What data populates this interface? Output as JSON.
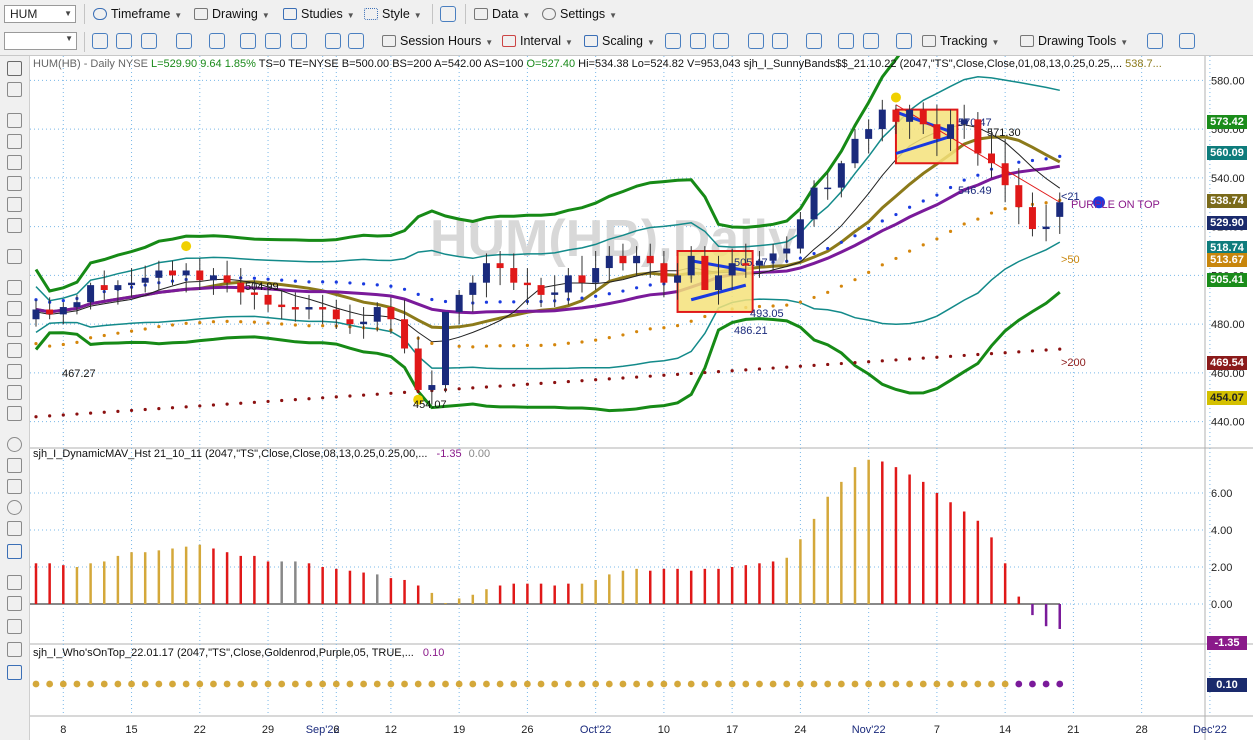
{
  "toolbar1": {
    "symbol": "HUM",
    "items": [
      "Timeframe",
      "Drawing",
      "Studies",
      "Style",
      "Data",
      "Settings"
    ]
  },
  "toolbar2": {
    "items": [
      "Session Hours",
      "Interval",
      "Scaling",
      "Tracking",
      "Drawing Tools"
    ]
  },
  "price_pane": {
    "watermark": "HUM(HB),Daily",
    "header": {
      "symbol": "HUM(HB) - Daily",
      "exchange": "NYSE",
      "last": "L=529.90",
      "change": "9.64",
      "change_pct": "1.85%",
      "fields": "TS=0 TE=NYSE B=500.00 BS=200 A=542.00 AS=100",
      "open": "O=527.40",
      "rest": "Hi=534.38 Lo=524.82 V=953,043",
      "study": "sjh_I_SunnyBands$$_21.10.22 (2047,\"TS\",Close,Close,01,08,13,0.25,0.25,...",
      "study_val": "538.7..."
    },
    "axis_ticks": [
      "580.00",
      "560.00",
      "540.00",
      "520.00",
      "500.00",
      "480.00",
      "460.00",
      "440.00"
    ],
    "tags": [
      {
        "text": "573.42",
        "color": "#1a8c1a"
      },
      {
        "text": "560.09",
        "color": "#0e7c7c"
      },
      {
        "text": "538.74",
        "color": "#7a6a1a"
      },
      {
        "text": "529.90",
        "color": "#1a2a6c"
      },
      {
        "text": "518.74",
        "color": "#0e7c7c"
      },
      {
        "text": "513.67",
        "color": "#c8860c"
      },
      {
        "text": "505.41",
        "color": "#1a8c1a"
      },
      {
        "text": "469.54",
        "color": "#8b1a1a"
      },
      {
        "text": "454.07",
        "color": "#d4c000"
      }
    ],
    "annotations": {
      "a570": "570.47",
      "a571": "571.30",
      "a546": "546.49",
      "a504": "504.99",
      "a505": "505.47",
      "a493": "493.05",
      "a486": "486.21",
      "a467": "467.27",
      "a454": "454.07",
      "ma21": "<21",
      "ma50": ">50",
      "ma200": ">200",
      "purple": "PURPLE ON TOP"
    }
  },
  "osc_pane": {
    "header": "sjh_I_DynamicMAV_Hst 21_10_11 (2047,\"TS\",Close,Close,08,13,0.25,0.25,00,...",
    "val1": "-1.35",
    "val2": "0.00",
    "axis_ticks": [
      "6.00",
      "4.00",
      "2.00",
      "0.00"
    ],
    "tag": "-1.35"
  },
  "who_pane": {
    "header": "sjh_I_Who'sOnTop_22.01.17 (2047,\"TS\",Close,Goldenrod,Purple,05, TRUE,...",
    "val": "0.10",
    "tag": "0.10"
  },
  "date_axis": [
    "8",
    "15",
    "22",
    "29",
    "Sep'22",
    "6",
    "12",
    "19",
    "26",
    "Oct'22",
    "10",
    "17",
    "24",
    "Nov'22",
    "7",
    "14",
    "21",
    "28",
    "Dec'22"
  ],
  "colors": {
    "up": "#1a2a7c",
    "down": "#e01818",
    "band_outer": "#168a16",
    "band_inner": "#138a8a",
    "ma21": "#7a1a9a",
    "ma_gold": "#8c7a1a",
    "dots_blue": "#1a3ae0",
    "dots_orange": "#d4860c",
    "dots_red": "#8b1010",
    "grid": "#7ab8e8"
  },
  "chart_data": [
    {
      "type": "candlestick",
      "title": "HUM(HB),Daily",
      "dates": [
        "Aug 4",
        "Aug 5",
        "Aug 8",
        "Aug 9",
        "Aug 10",
        "Aug 11",
        "Aug 12",
        "Aug 15",
        "Aug 16",
        "Aug 17",
        "Aug 18",
        "Aug 19",
        "Aug 22",
        "Aug 23",
        "Aug 24",
        "Aug 25",
        "Aug 26",
        "Aug 29",
        "Aug 30",
        "Aug 31",
        "Sep 1",
        "Sep 2",
        "Sep 6",
        "Sep 7",
        "Sep 8",
        "Sep 9",
        "Sep 12",
        "Sep 13",
        "Sep 14",
        "Sep 15",
        "Sep 16",
        "Sep 19",
        "Sep 20",
        "Sep 21",
        "Sep 22",
        "Sep 23",
        "Sep 26",
        "Sep 27",
        "Sep 28",
        "Sep 29",
        "Sep 30",
        "Oct 3",
        "Oct 4",
        "Oct 5",
        "Oct 6",
        "Oct 7",
        "Oct 10",
        "Oct 11",
        "Oct 12",
        "Oct 13",
        "Oct 14",
        "Oct 17",
        "Oct 18",
        "Oct 19",
        "Oct 20",
        "Oct 21",
        "Oct 24",
        "Oct 25",
        "Oct 26",
        "Oct 27",
        "Oct 28",
        "Oct 31",
        "Nov 1",
        "Nov 2",
        "Nov 3",
        "Nov 4",
        "Nov 7",
        "Nov 8",
        "Nov 9",
        "Nov 10",
        "Nov 11",
        "Nov 14",
        "Nov 15",
        "Nov 16",
        "Nov 17",
        "Nov 18"
      ],
      "open": [
        482,
        486,
        484,
        487,
        489,
        496,
        494,
        496,
        497,
        499,
        502,
        500,
        502,
        498,
        500,
        497,
        493,
        492,
        488,
        487,
        486,
        487,
        486,
        482,
        480,
        481,
        487,
        482,
        470,
        453,
        455,
        485,
        492,
        497,
        505,
        503,
        497,
        496,
        492,
        493,
        500,
        497,
        503,
        508,
        505,
        508,
        505,
        497,
        500,
        508,
        494,
        500,
        505,
        504,
        506,
        509,
        511,
        523,
        536,
        536,
        546,
        556,
        560,
        568,
        563,
        568,
        562,
        556,
        562,
        564,
        550,
        546,
        537,
        528,
        519,
        524
      ],
      "high": [
        490,
        491,
        489,
        492,
        497,
        502,
        498,
        503,
        504,
        506,
        506,
        505,
        507,
        503,
        506,
        503,
        498,
        496,
        494,
        493,
        492,
        492,
        490,
        488,
        487,
        489,
        491,
        490,
        475,
        461,
        477,
        494,
        500,
        509,
        510,
        509,
        503,
        499,
        500,
        503,
        508,
        510,
        512,
        513,
        512,
        513,
        510,
        505,
        512,
        512,
        508,
        511,
        513,
        510,
        513,
        516,
        526,
        539,
        542,
        547,
        560,
        564,
        572,
        570,
        570,
        571,
        570,
        568,
        570,
        567,
        560,
        556,
        544,
        534,
        529,
        534
      ],
      "low": [
        479,
        482,
        480,
        484,
        486,
        490,
        488,
        491,
        493,
        494,
        496,
        493,
        494,
        492,
        493,
        488,
        486,
        485,
        482,
        481,
        482,
        480,
        478,
        476,
        474,
        477,
        476,
        468,
        454,
        447,
        452,
        480,
        485,
        491,
        496,
        494,
        488,
        487,
        487,
        488,
        493,
        494,
        498,
        502,
        500,
        499,
        491,
        490,
        497,
        494,
        488,
        494,
        499,
        499,
        502,
        505,
        509,
        520,
        531,
        532,
        544,
        550,
        555,
        558,
        556,
        558,
        549,
        551,
        556,
        545,
        540,
        530,
        521,
        516,
        514,
        517
      ],
      "close": [
        486,
        484,
        487,
        489,
        496,
        494,
        496,
        497,
        499,
        502,
        500,
        502,
        498,
        500,
        497,
        493,
        492,
        488,
        487,
        486,
        487,
        486,
        482,
        480,
        481,
        487,
        482,
        470,
        453,
        455,
        485,
        492,
        497,
        505,
        503,
        497,
        496,
        492,
        493,
        500,
        497,
        503,
        508,
        505,
        508,
        505,
        497,
        500,
        508,
        494,
        500,
        505,
        504,
        506,
        509,
        511,
        523,
        536,
        536,
        546,
        556,
        560,
        568,
        563,
        568,
        562,
        556,
        562,
        564,
        550,
        546,
        537,
        528,
        519,
        520,
        530
      ],
      "ylim": [
        430,
        590
      ]
    },
    {
      "type": "bar",
      "title": "sjh_I_DynamicMAV_Hst 21_10_11",
      "values": [
        2.2,
        2.2,
        2.1,
        2.0,
        2.2,
        2.3,
        2.6,
        2.8,
        2.8,
        2.9,
        3.0,
        3.1,
        3.2,
        3.0,
        2.8,
        2.6,
        2.6,
        2.3,
        2.3,
        2.3,
        2.2,
        2.0,
        1.9,
        1.8,
        1.7,
        1.6,
        1.4,
        1.3,
        1.0,
        0.6,
        0.05,
        0.3,
        0.5,
        0.8,
        1.0,
        1.1,
        1.1,
        1.1,
        1.0,
        1.1,
        1.1,
        1.3,
        1.6,
        1.8,
        1.9,
        1.8,
        1.9,
        1.9,
        1.8,
        1.9,
        1.9,
        2.0,
        2.1,
        2.2,
        2.3,
        2.5,
        3.5,
        4.6,
        5.8,
        6.6,
        7.4,
        7.8,
        7.7,
        7.4,
        7.0,
        6.6,
        6.0,
        5.5,
        5.0,
        4.5,
        3.6,
        2.2,
        0.4,
        -0.6,
        -1.2,
        -1.35
      ],
      "ylim": [
        -2,
        8
      ]
    },
    {
      "type": "scatter",
      "title": "sjh_I_Who'sOnTop_22.01.17",
      "values": [
        0.1
      ],
      "ylim": [
        0,
        0.2
      ]
    }
  ]
}
